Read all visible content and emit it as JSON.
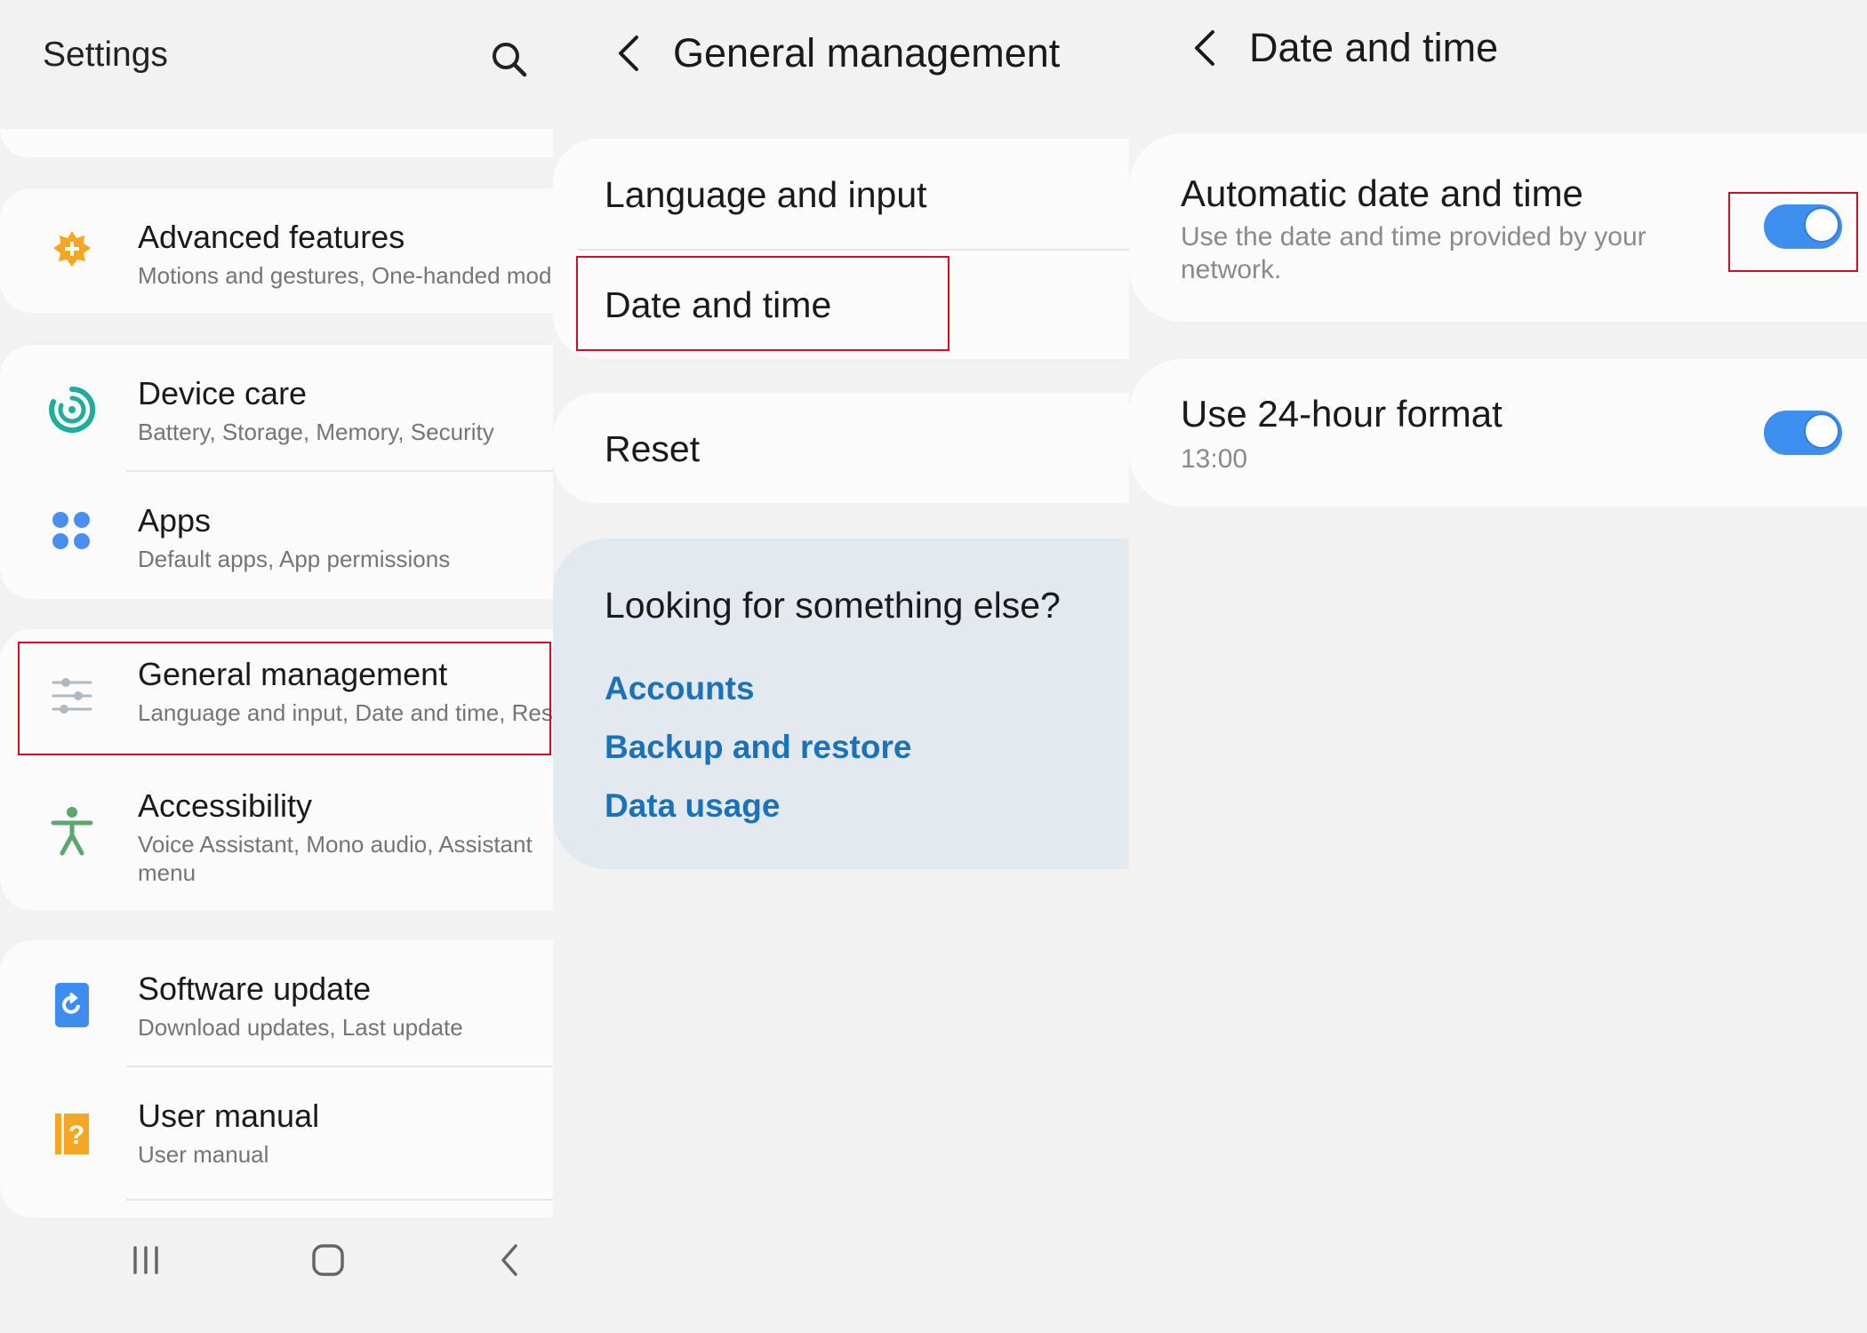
{
  "settings": {
    "title": "Settings",
    "items": [
      {
        "title": "Advanced features",
        "subtitle": "Motions and gestures, One-handed mod",
        "icon": "puzzle-gear-icon",
        "icon_color": "#f5a623"
      },
      {
        "title": "Device care",
        "subtitle": "Battery, Storage, Memory, Security",
        "icon": "device-care-icon",
        "icon_color": "#1fae9a"
      },
      {
        "title": "Apps",
        "subtitle": "Default apps, App permissions",
        "icon": "apps-dots-icon",
        "icon_color": "#4a8ff0"
      },
      {
        "title": "General management",
        "subtitle": "Language and input, Date and time, Res",
        "icon": "sliders-icon",
        "icon_color": "#b0b8c0",
        "highlighted": true
      },
      {
        "title": "Accessibility",
        "subtitle_line1": "Voice Assistant, Mono audio, Assistant",
        "subtitle_line2": "menu",
        "icon": "accessibility-person-icon",
        "icon_color": "#5aa86b"
      },
      {
        "title": "Software update",
        "subtitle": "Download updates, Last update",
        "icon": "software-update-icon",
        "icon_color": "#3f8cf0"
      },
      {
        "title": "User manual",
        "subtitle": "User manual",
        "icon": "user-manual-icon",
        "icon_color": "#f5a623"
      }
    ],
    "nav": {
      "recents": "recents-icon",
      "home": "home-icon",
      "back": "back-icon"
    }
  },
  "general_management": {
    "title": "General management",
    "items": [
      "Language and input",
      "Date and time",
      "Reset"
    ],
    "suggestions": {
      "title": "Looking for something else?",
      "links": [
        "Accounts",
        "Backup and restore",
        "Data usage"
      ]
    }
  },
  "date_and_time": {
    "title": "Date and time",
    "automatic": {
      "title": "Automatic date and time",
      "subtitle": "Use the date and time provided by your network.",
      "enabled": true
    },
    "format_24h": {
      "title": "Use 24-hour format",
      "subtitle": "13:00",
      "enabled": true
    }
  },
  "colors": {
    "accent": "#3e8ef0",
    "link": "#1a73b8",
    "highlight": "#c8102e"
  }
}
